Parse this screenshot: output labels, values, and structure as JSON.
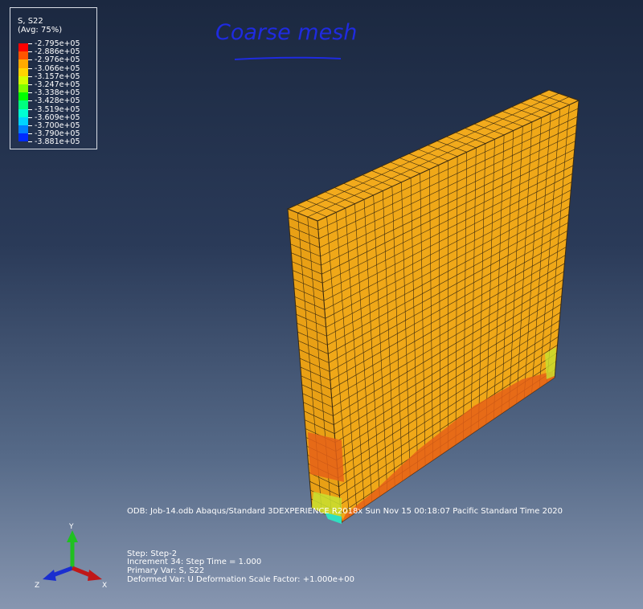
{
  "legend": {
    "title": "S, S22",
    "subtitle": "(Avg: 75%)",
    "entries": [
      {
        "value": "-2.795e+05",
        "color": "#ff0000"
      },
      {
        "value": "-2.886e+05",
        "color": "#ff5500"
      },
      {
        "value": "-2.976e+05",
        "color": "#ffaa00"
      },
      {
        "value": "-3.066e+05",
        "color": "#ffd400"
      },
      {
        "value": "-3.157e+05",
        "color": "#d4ff00"
      },
      {
        "value": "-3.247e+05",
        "color": "#7fff00"
      },
      {
        "value": "-3.338e+05",
        "color": "#00ff00"
      },
      {
        "value": "-3.428e+05",
        "color": "#00ff7f"
      },
      {
        "value": "-3.519e+05",
        "color": "#00ffd4"
      },
      {
        "value": "-3.609e+05",
        "color": "#00d4ff"
      },
      {
        "value": "-3.700e+05",
        "color": "#0080ff"
      },
      {
        "value": "-3.790e+05",
        "color": "#002aff"
      },
      {
        "value": "-3.881e+05",
        "color": "#0000ff"
      }
    ]
  },
  "annotation": {
    "text": "Coarse mesh",
    "color": "#1f2be0"
  },
  "viewport_info": {
    "odb_line": "ODB: Job-14.odb     Abaqus/Standard 3DEXPERIENCE R2018x     Sun Nov 15 00:18:07 Pacific Standard Time 2020",
    "step_line": "Step: Step-2",
    "increment_line": "Increment     34: Step Time =     1.000",
    "primary_var_line": "Primary Var: S, S22",
    "deformed_var_line": "Deformed Var: U   Deformation Scale Factor: +1.000e+00"
  },
  "triad": {
    "y_label": "Y",
    "z_label": "Z",
    "x_label": "X"
  },
  "colors": {
    "mesh_base": "#f0a818",
    "mesh_line": "#3a2a10",
    "hot": "#e56018",
    "warm_green": "#c8e030",
    "cool_cyan": "#30e0c0"
  }
}
